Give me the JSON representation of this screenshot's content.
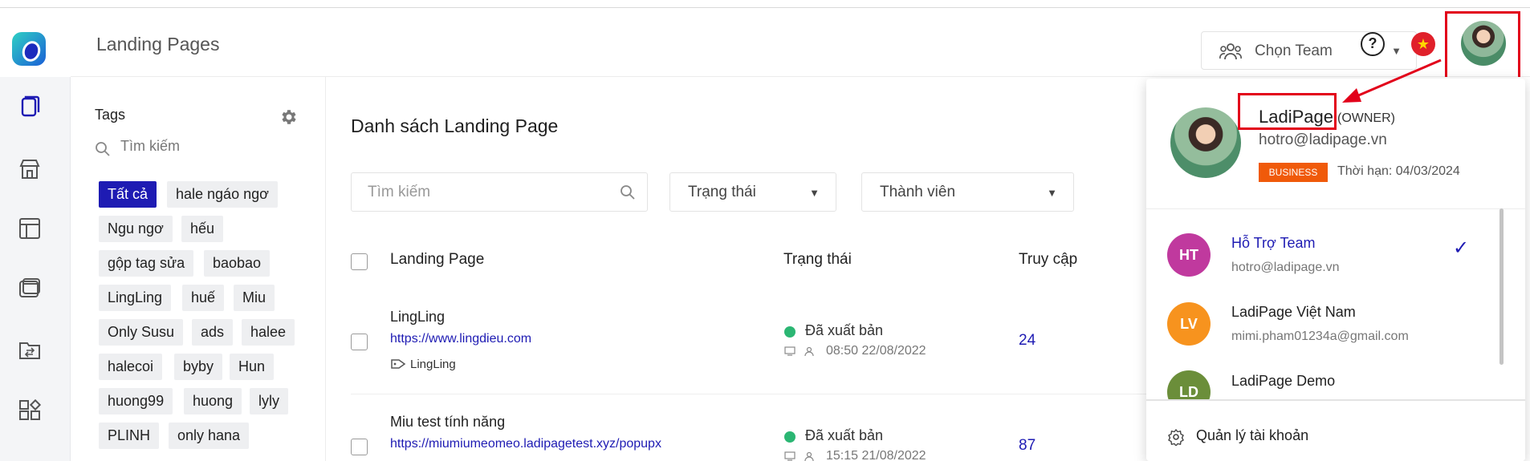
{
  "header": {
    "title": "Landing Pages",
    "team_select": "Chọn Team"
  },
  "tags": {
    "title": "Tags",
    "search_placeholder": "Tìm kiếm",
    "items": [
      "Tất cả",
      "hale ngáo ngơ",
      "Ngu ngơ",
      "hếu",
      "gộp tag sửa",
      "baobao",
      "LingLing",
      "huế",
      "Miu",
      "Only Susu",
      "ads",
      "halee",
      "halecoi",
      "byby",
      "Hun",
      "huong99",
      "huong",
      "lyly",
      "PLINH",
      "only hana"
    ]
  },
  "main": {
    "title": "Danh sách Landing Page",
    "search_placeholder": "Tìm kiếm",
    "status_filter": "Trạng thái",
    "member_filter": "Thành viên",
    "columns": [
      "Landing Page",
      "Trạng thái",
      "Truy cập"
    ],
    "rows": [
      {
        "name": "LingLing",
        "url": "https://www.lingdieu.com",
        "tag": "LingLing",
        "status": "Đã xuất bản",
        "time": "08:50 22/08/2022",
        "visits": "24"
      },
      {
        "name": "Miu test tính năng",
        "url": "https://miumiumeomeo.ladipagetest.xyz/popupx",
        "tag": "",
        "status": "Đã xuất bản",
        "time": "15:15 21/08/2022",
        "visits": "87"
      }
    ]
  },
  "account_panel": {
    "name": "LadiPage",
    "role": "(OWNER)",
    "email": "hotro@ladipage.vn",
    "plan": "BUSINESS",
    "expiry": "Thời hạn: 04/03/2024",
    "accounts": [
      {
        "initials": "HT",
        "name": "Hỗ Trợ Team",
        "email": "hotro@ladipage.vn",
        "color": "#c0399e",
        "selected": true
      },
      {
        "initials": "LV",
        "name": "LadiPage Việt Nam",
        "email": "mimi.pham01234a@gmail.com",
        "color": "#f7931e",
        "selected": false
      },
      {
        "initials": "LD",
        "name": "LadiPage Demo",
        "email": "",
        "color": "#6b8e3a",
        "selected": false
      }
    ],
    "manage_label": "Quản lý tài khoản"
  },
  "colors": {
    "accent": "#1e1bb3",
    "highlight": "#e2001a",
    "plan_badge": "#f05a0a",
    "published": "#2bb673"
  }
}
